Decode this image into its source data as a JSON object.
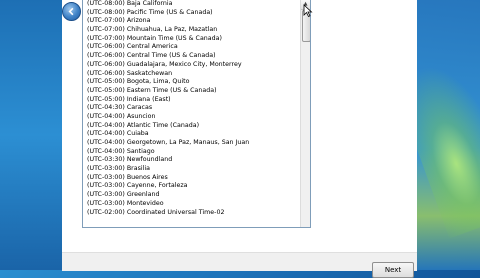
{
  "wizard": {
    "next_label": "Next"
  },
  "timezone_list": {
    "items": [
      "(UTC-08:00) Baja California",
      "(UTC-08:00) Pacific Time (US & Canada)",
      "(UTC-07:00) Arizona",
      "(UTC-07:00) Chihuahua, La Paz, Mazatlan",
      "(UTC-07:00) Mountain Time (US & Canada)",
      "(UTC-06:00) Central America",
      "(UTC-06:00) Central Time (US & Canada)",
      "(UTC-06:00) Guadalajara, Mexico City, Monterrey",
      "(UTC-06:00) Saskatchewan",
      "(UTC-05:00) Bogota, Lima, Quito",
      "(UTC-05:00) Eastern Time (US & Canada)",
      "(UTC-05:00) Indiana (East)",
      "(UTC-04:30) Caracas",
      "(UTC-04:00) Asuncion",
      "(UTC-04:00) Atlantic Time (Canada)",
      "(UTC-04:00) Cuiaba",
      "(UTC-04:00) Georgetown, La Paz, Manaus, San Juan",
      "(UTC-04:00) Santiago",
      "(UTC-03:30) Newfoundland",
      "(UTC-03:00) Brasilia",
      "(UTC-03:00) Buenos Aires",
      "(UTC-03:00) Cayenne, Fortaleza",
      "(UTC-03:00) Greenland",
      "(UTC-03:00) Montevideo",
      "(UTC-02:00) Coordinated Universal Time-02"
    ]
  },
  "icons": {
    "back": "back-arrow-icon",
    "cursor": "mouse-cursor-icon",
    "scroll_up": "scroll-up-arrow-icon"
  }
}
